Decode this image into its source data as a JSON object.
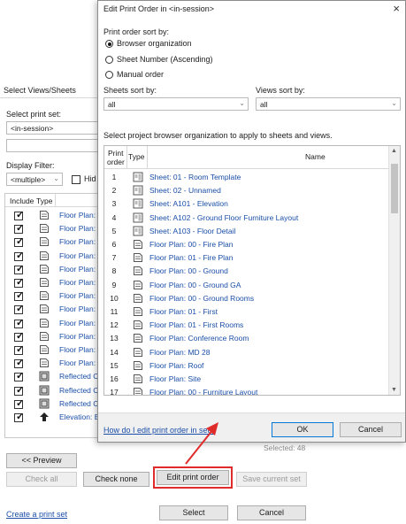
{
  "background_dialog": {
    "title": "Select Views/Sheets",
    "print_set_label": "Select print set:",
    "print_set_value": "<in-session>",
    "display_filter_label": "Display Filter:",
    "display_filter_value": "<multiple>",
    "hide_label": "Hid",
    "table_headers": {
      "include": "Include",
      "type": "Type"
    },
    "rows": [
      {
        "icon": "view-icon",
        "name": "Floor Plan: "
      },
      {
        "icon": "view-icon",
        "name": "Floor Plan:"
      },
      {
        "icon": "view-icon",
        "name": "Floor Plan:"
      },
      {
        "icon": "view-icon",
        "name": "Floor Plan:"
      },
      {
        "icon": "view-icon",
        "name": "Floor Plan:"
      },
      {
        "icon": "view-icon",
        "name": "Floor Plan:"
      },
      {
        "icon": "view-icon",
        "name": "Floor Plan:"
      },
      {
        "icon": "view-icon",
        "name": "Floor Plan:"
      },
      {
        "icon": "view-icon",
        "name": "Floor Plan:"
      },
      {
        "icon": "view-icon",
        "name": "Floor Plan:"
      },
      {
        "icon": "view-icon",
        "name": "Floor Plan:"
      },
      {
        "icon": "view-icon",
        "name": "Floor Plan:"
      },
      {
        "icon": "reflected-view-icon",
        "name": "Reflected C"
      },
      {
        "icon": "reflected-view-icon",
        "name": "Reflected C"
      },
      {
        "icon": "reflected-view-icon",
        "name": "Reflected C"
      },
      {
        "icon": "elevation-icon",
        "name": "Elevation: E"
      }
    ],
    "selected_count": "Selected: 48",
    "preview_button": "<< Preview",
    "check_all_button": "Check all",
    "check_none_button": "Check none",
    "edit_print_order_button": "Edit print order",
    "save_current_set_button": "Save current set",
    "create_print_set_link": "Create a print set",
    "select_button": "Select",
    "cancel_button": "Cancel"
  },
  "dialog": {
    "title": "Edit Print Order in <in-session>",
    "close_icon": "×",
    "sort_by_label": "Print order sort by:",
    "sort_options": [
      {
        "label": "Browser organization",
        "selected": true
      },
      {
        "label": "Sheet Number (Ascending)",
        "selected": false
      },
      {
        "label": "Manual order",
        "selected": false
      }
    ],
    "sheets_sort_label": "Sheets sort by:",
    "sheets_sort_value": "all",
    "views_sort_label": "Views sort by:",
    "views_sort_value": "all",
    "instruction": "Select project browser organization to apply to sheets and views.",
    "grid_headers": {
      "print": "Print",
      "order": "order",
      "type": "Type",
      "name": "Name"
    },
    "rows": [
      {
        "order": "1",
        "icon": "sheet-icon",
        "name": "Sheet: 01 - Room Template"
      },
      {
        "order": "2",
        "icon": "sheet-icon",
        "name": "Sheet: 02 - Unnamed"
      },
      {
        "order": "3",
        "icon": "sheet-icon",
        "name": "Sheet: A101 - Elevation"
      },
      {
        "order": "4",
        "icon": "sheet-icon",
        "name": "Sheet: A102 - Ground Floor Furniture Layout"
      },
      {
        "order": "5",
        "icon": "sheet-icon",
        "name": "Sheet: A103 - Floor Detail"
      },
      {
        "order": "6",
        "icon": "view-icon",
        "name": "Floor Plan: 00 - Fire Plan"
      },
      {
        "order": "7",
        "icon": "view-icon",
        "name": "Floor Plan: 01 - Fire Plan"
      },
      {
        "order": "8",
        "icon": "view-icon",
        "name": "Floor Plan: 00 - Ground"
      },
      {
        "order": "9",
        "icon": "view-icon",
        "name": "Floor Plan: 00 - Ground GA"
      },
      {
        "order": "10",
        "icon": "view-icon",
        "name": "Floor Plan: 00 - Ground Rooms"
      },
      {
        "order": "11",
        "icon": "view-icon",
        "name": "Floor Plan: 01 - First"
      },
      {
        "order": "12",
        "icon": "view-icon",
        "name": "Floor Plan: 01 - First Rooms"
      },
      {
        "order": "13",
        "icon": "view-icon",
        "name": "Floor Plan: Conference Room"
      },
      {
        "order": "14",
        "icon": "view-icon",
        "name": "Floor Plan: MD 28"
      },
      {
        "order": "15",
        "icon": "view-icon",
        "name": "Floor Plan: Roof"
      },
      {
        "order": "16",
        "icon": "view-icon",
        "name": "Floor Plan: Site"
      },
      {
        "order": "17",
        "icon": "view-icon",
        "name": "Floor Plan: 00 - Furniture Layout"
      }
    ],
    "help_link": "How do I edit print order in set?",
    "ok_button": "OK",
    "cancel_button": "Cancel"
  },
  "colors": {
    "link": "#1a4ea8",
    "highlight": "#e02b2b",
    "accent": "#0078d7"
  }
}
